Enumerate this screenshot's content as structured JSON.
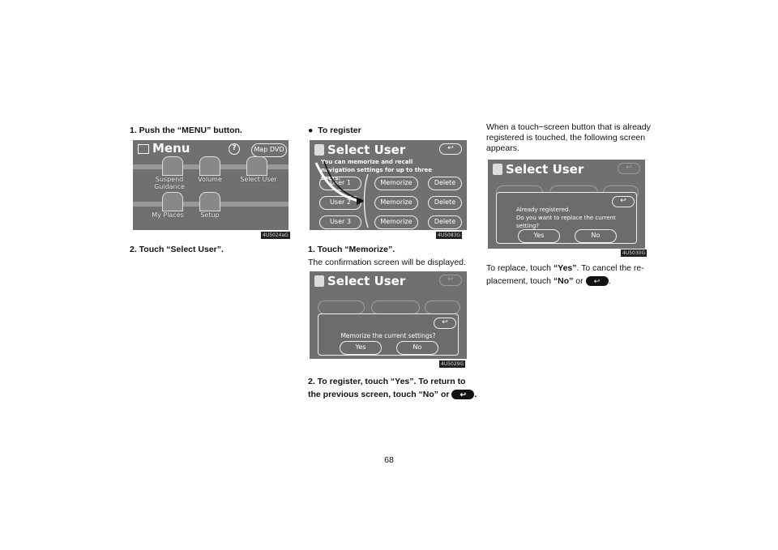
{
  "col1": {
    "step1": "1. Push the “MENU” button.",
    "step2": "2. Touch “Select User”.",
    "screen": {
      "title": "Menu",
      "help": "?",
      "map_dvd": "Map DVD",
      "items": [
        "Suspend Guidance",
        "Volume",
        "Select User",
        "My Places",
        "Setup"
      ],
      "code": "4U5024aG"
    }
  },
  "col2": {
    "bullet": "●",
    "heading": "To register",
    "screen": {
      "title": "Select User",
      "back": "↩",
      "message": "You can memorize and recall navigation settings for up to three users.",
      "users": [
        "User 1",
        "User 2",
        "User 3"
      ],
      "memorize": "Memorize",
      "delete": "Delete",
      "code": "4U5083G"
    },
    "step1": "1. Touch “Memorize”.",
    "desc": "The confirmation screen will be displayed.",
    "confirm": {
      "title": "Select User",
      "back": "↩",
      "question": "Memorize the current settings?",
      "yes": "Yes",
      "no": "No",
      "code": "4U5029G"
    },
    "step2_a": "2. To register, touch “Yes”.  To return to",
    "step2_b": "the previous screen, touch “No” or"
  },
  "col3": {
    "intro": [
      "When a touch−screen button that is already",
      "registered is touched, the following screen",
      "appears."
    ],
    "screen": {
      "title": "Select User",
      "back": "↩",
      "line1": "Already registered.",
      "line2": "Do you want to replace the current",
      "line3": "setting?",
      "yes": "Yes",
      "no": "No",
      "code": "4U5030G"
    },
    "text_a1": "To replace, touch ",
    "text_a2": "“Yes”",
    "text_a3": ".  To cancel the re-",
    "text_b1": "placement, touch ",
    "text_b2": "“No”",
    "text_b3": " or"
  },
  "page_number": "68"
}
